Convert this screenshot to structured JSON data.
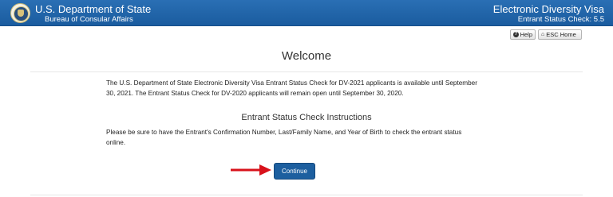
{
  "header": {
    "org_title": "U.S. Department of State",
    "org_subtitle": "Bureau of Consular Affairs",
    "app_title": "Electronic Diversity Visa",
    "app_subtitle": "Entrant Status Check: 5.5",
    "seal_icon": "department-of-state-seal-icon"
  },
  "toolbar": {
    "help_label": "Help",
    "help_icon": "question-circle-icon",
    "home_label": "ESC Home",
    "home_icon": "home-icon"
  },
  "main": {
    "title": "Welcome",
    "notice_text": "The U.S. Department of State Electronic Diversity Visa Entrant Status Check for DV-2021 applicants is available until September 30, 2021. The Entrant Status Check for DV-2020 applicants will remain open until September 30, 2020.",
    "instructions_heading": "Entrant Status Check Instructions",
    "instructions_text": "Please be sure to have the Entrant's Confirmation Number, Last/Family Name, and Year of Birth to check the entrant status online.",
    "continue_label": "Continue",
    "arrow_icon": "red-arrow-right-icon"
  },
  "colors": {
    "header_blue": "#1e64a8",
    "button_blue": "#1d5f9f",
    "arrow_red": "#d8121b"
  }
}
